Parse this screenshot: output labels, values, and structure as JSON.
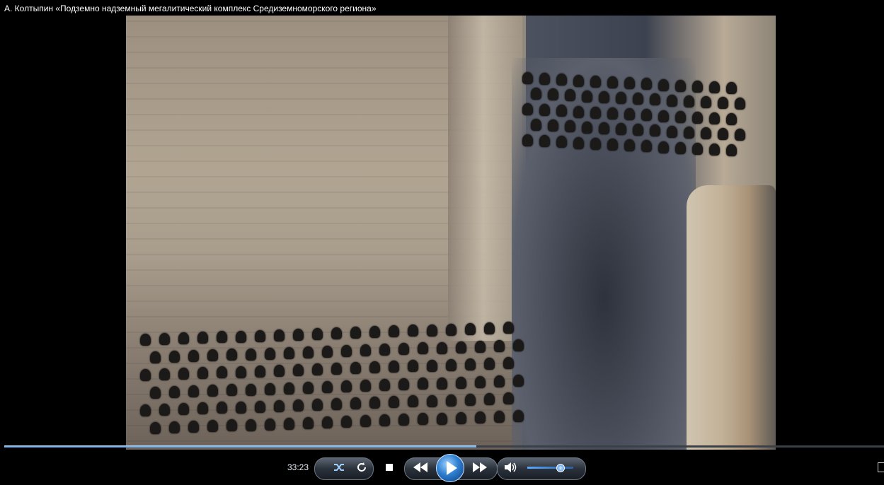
{
  "window": {
    "title": "А. Колтыпин «Подземно надземный мегалитический комплекс Средиземноморского региона»"
  },
  "player": {
    "time": "33:23",
    "progress_fraction": 0.537,
    "volume_fraction": 0.7,
    "icons": {
      "shuffle": "shuffle-icon",
      "repeat": "repeat-icon",
      "stop": "stop-icon",
      "previous": "rewind-icon",
      "play": "play-icon",
      "next": "fast-forward-icon",
      "volume": "speaker-icon",
      "switch_view": "switch-view-icon"
    },
    "accent": "#2e7fd1"
  }
}
